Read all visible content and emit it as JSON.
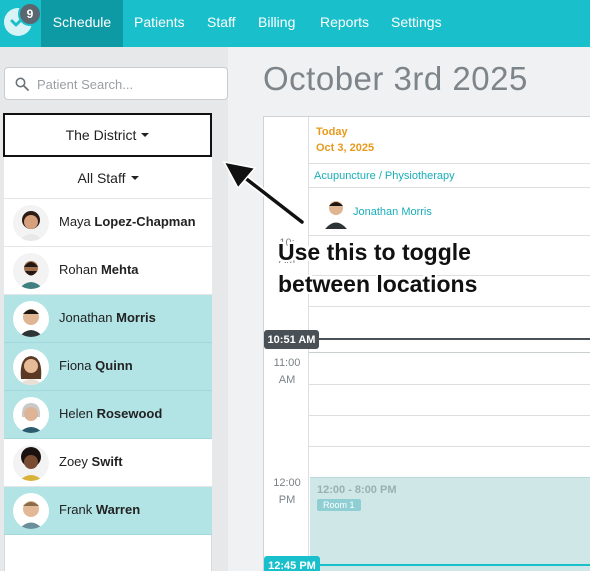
{
  "nav": {
    "notification_count": "9",
    "tabs": [
      {
        "label": "Schedule",
        "active": true
      },
      {
        "label": "Patients",
        "active": false
      },
      {
        "label": "Staff",
        "active": false
      },
      {
        "label": "Billing",
        "active": false
      },
      {
        "label": "Reports",
        "active": false
      },
      {
        "label": "Settings",
        "active": false
      }
    ],
    "accent_color": "#19bfcb"
  },
  "sidebar": {
    "search_placeholder": "Patient Search...",
    "location": "The District",
    "staff_filter": "All Staff",
    "staff": [
      {
        "first": "Maya",
        "last": "Lopez-Chapman",
        "selected": false
      },
      {
        "first": "Rohan",
        "last": "Mehta",
        "selected": false
      },
      {
        "first": "Jonathan",
        "last": "Morris",
        "selected": true
      },
      {
        "first": "Fiona",
        "last": "Quinn",
        "selected": true
      },
      {
        "first": "Helen",
        "last": "Rosewood",
        "selected": true
      },
      {
        "first": "Zoey",
        "last": "Swift",
        "selected": false
      },
      {
        "first": "Frank",
        "last": "Warren",
        "selected": true
      }
    ]
  },
  "main": {
    "title": "October 3rd 2025",
    "calendar": {
      "today_label": "Today",
      "today_date": "Oct 3, 2025",
      "service": "Acupuncture / Physiotherapy",
      "practitioner": "Jonathan Morris",
      "time_labels": [
        {
          "line1": "10:",
          "line2": "AM"
        },
        {
          "line1": "11:00",
          "line2": "AM"
        },
        {
          "line1": "12:00",
          "line2": "PM"
        }
      ],
      "now_time": "10:51 AM",
      "appointment": {
        "time": "12:00 - 8:00 PM",
        "room": "Room 1"
      },
      "bottom_time": "12:45 PM"
    }
  },
  "annotation": {
    "line1": "Use this to toggle",
    "line2": "between locations"
  }
}
